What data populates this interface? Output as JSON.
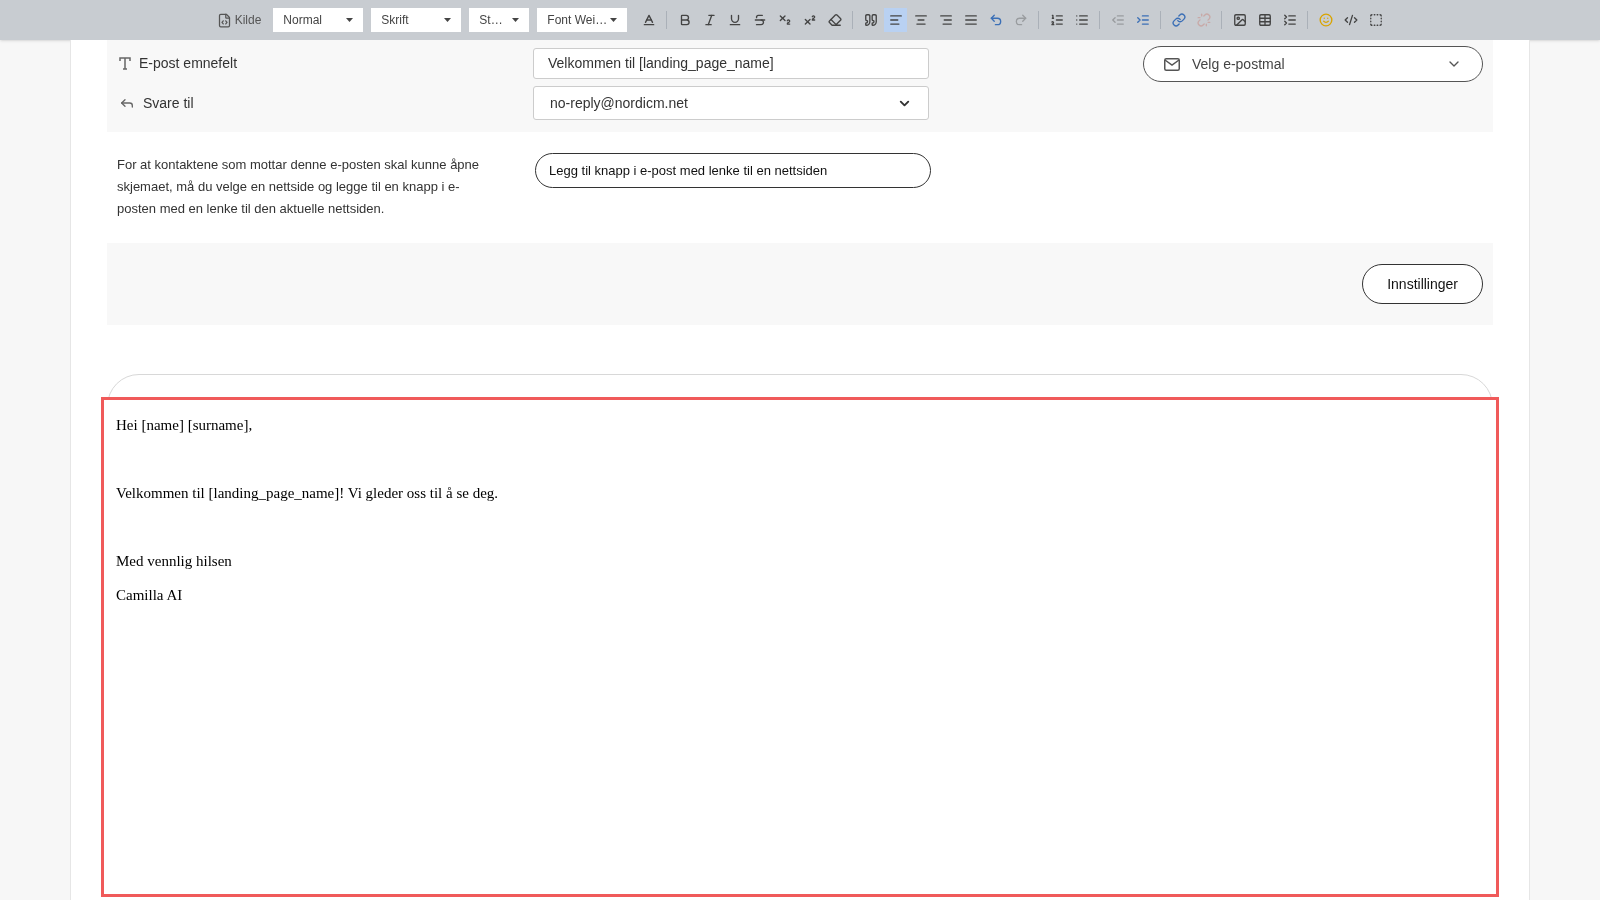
{
  "toolbar": {
    "source_button": {
      "label": "Kilde"
    },
    "dropdowns": [
      {
        "label": "Normal"
      },
      {
        "label": "Skrift"
      },
      {
        "label": "St…"
      },
      {
        "label": "Font Wei…"
      }
    ],
    "buttons": [
      {
        "kind": "text-color",
        "disabled": false,
        "selected": false
      },
      {
        "kind": "bold",
        "disabled": false,
        "selected": false
      },
      {
        "kind": "italic",
        "disabled": false,
        "selected": false
      },
      {
        "kind": "underline",
        "disabled": false,
        "selected": false
      },
      {
        "kind": "strike",
        "disabled": false,
        "selected": false
      },
      {
        "kind": "subscript",
        "disabled": false,
        "selected": false
      },
      {
        "kind": "superscript",
        "disabled": false,
        "selected": false
      },
      {
        "kind": "clear-format",
        "disabled": false,
        "selected": false
      },
      {
        "kind": "quote",
        "disabled": false,
        "selected": false
      },
      {
        "kind": "align-left",
        "disabled": false,
        "selected": true
      },
      {
        "kind": "align-center",
        "disabled": false,
        "selected": false
      },
      {
        "kind": "align-right",
        "disabled": false,
        "selected": false
      },
      {
        "kind": "align-justify",
        "disabled": false,
        "selected": false
      },
      {
        "kind": "undo",
        "disabled": false,
        "selected": false
      },
      {
        "kind": "redo",
        "disabled": true,
        "selected": false
      },
      {
        "kind": "numbered-list",
        "disabled": false,
        "selected": false
      },
      {
        "kind": "bullet-list",
        "disabled": false,
        "selected": false
      },
      {
        "kind": "outdent",
        "disabled": true,
        "selected": false
      },
      {
        "kind": "indent",
        "disabled": false,
        "selected": false
      },
      {
        "kind": "link",
        "disabled": false,
        "selected": false
      },
      {
        "kind": "unlink",
        "disabled": true,
        "selected": false
      },
      {
        "kind": "image",
        "disabled": false,
        "selected": false
      },
      {
        "kind": "table",
        "disabled": false,
        "selected": false
      },
      {
        "kind": "line-height",
        "disabled": false,
        "selected": false
      },
      {
        "kind": "emoji",
        "disabled": false,
        "selected": false
      },
      {
        "kind": "div",
        "disabled": false,
        "selected": false
      },
      {
        "kind": "show-blocks",
        "disabled": false,
        "selected": false
      }
    ]
  },
  "fields": [
    {
      "kind": "subject",
      "label": "E-post emnefelt",
      "value": "Velkommen til [landing_page_name]"
    },
    {
      "kind": "reply-to",
      "label": "Svare til",
      "value": "no-reply@nordicm.net"
    }
  ],
  "template_select": {
    "placeholder": "Velg e-postmal"
  },
  "landing_page_note": {
    "text": "For at kontaktene som mottar denne e-posten skal kunne åpne skjemaet, må du velge en nettside og legge til en knapp i e-posten med en lenke til den aktuelle nettsiden.",
    "button": "Legg til knapp i e-post med lenke til en nettsiden"
  },
  "settings_button": {
    "label": "Innstillinger"
  },
  "editor": {
    "blocks": [
      [
        "Hei [name] [surname],"
      ],
      [
        "Velkommen til [landing_page_name]! Vi gleder oss til å se deg."
      ],
      [
        "Med vennlig hilsen",
        "Camilla AI"
      ]
    ]
  }
}
